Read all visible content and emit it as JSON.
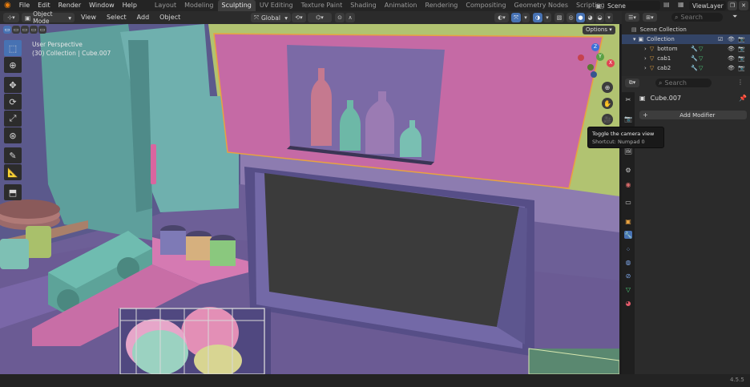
{
  "topbar": {
    "menus": [
      "File",
      "Edit",
      "Render",
      "Window",
      "Help"
    ],
    "workspaces": [
      "Layout",
      "Modeling",
      "Sculpting",
      "UV Editing",
      "Texture Paint",
      "Shading",
      "Animation",
      "Rendering",
      "Compositing",
      "Geometry Nodes",
      "Scripting",
      "+"
    ],
    "active_workspace": "Sculpting",
    "scene": "Scene",
    "viewlayer": "ViewLayer"
  },
  "header": {
    "mode": "Object Mode",
    "menus": [
      "View",
      "Select",
      "Add",
      "Object"
    ],
    "orientation": "Global",
    "options": "Options"
  },
  "viewport": {
    "perspective": "User Perspective",
    "collection_info": "(30) Collection | Cube.007"
  },
  "tooltip": {
    "title": "Toggle the camera view",
    "shortcut": "Shortcut: Numpad 0"
  },
  "outliner": {
    "search_placeholder": "Search",
    "scene_collection": "Scene Collection",
    "collection": "Collection",
    "objects": [
      "bottom",
      "cab1",
      "cab2"
    ]
  },
  "properties": {
    "search_placeholder": "Search",
    "object_name": "Cube.007",
    "add_modifier": "Add Modifier"
  },
  "status": {
    "version": "4.5.5"
  },
  "colors": {
    "accent": "#4772b3",
    "selection_outline": "#e8a240",
    "pink_cabinet": "#c56aa5",
    "wall_green": "#b0c26f",
    "teal_cabinet": "#5e9f9c"
  }
}
